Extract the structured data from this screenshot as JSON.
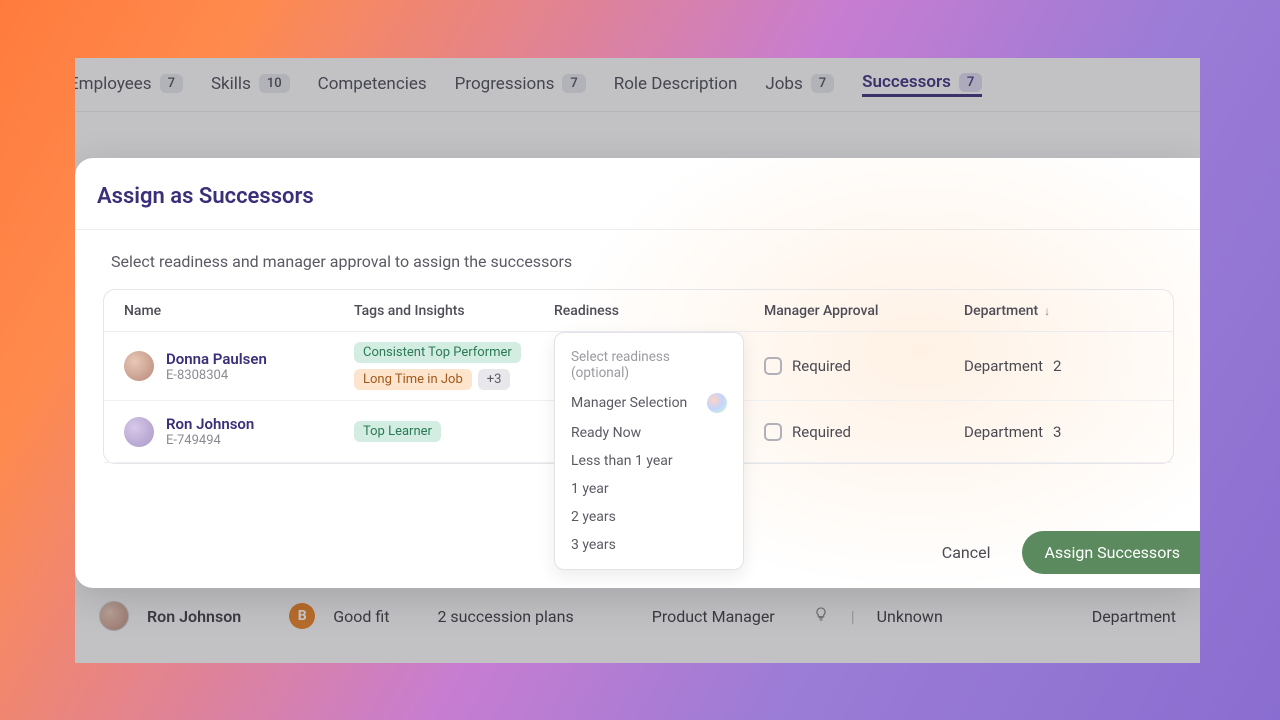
{
  "tabs": [
    {
      "label": "Employees",
      "badge": "7"
    },
    {
      "label": "Skills",
      "badge": "10"
    },
    {
      "label": "Competencies",
      "badge": ""
    },
    {
      "label": "Progressions",
      "badge": "7"
    },
    {
      "label": "Role Description",
      "badge": ""
    },
    {
      "label": "Jobs",
      "badge": "7"
    },
    {
      "label": "Successors",
      "badge": "7"
    }
  ],
  "active_tab_index": 6,
  "modal": {
    "title": "Assign as Successors",
    "subtitle": "Select readiness and manager approval to assign the successors",
    "columns": {
      "name": "Name",
      "tags": "Tags and Insights",
      "readiness": "Readiness",
      "approval": "Manager Approval",
      "department": "Department"
    },
    "rows": [
      {
        "name": "Donna Paulsen",
        "id": "E-8308304",
        "tags": [
          {
            "text": "Consistent Top Performer",
            "variant": "green"
          },
          {
            "text": "Long Time in Job",
            "variant": "orange"
          },
          {
            "text": "+3",
            "variant": "gray"
          }
        ],
        "approval": "Required",
        "department": "Department",
        "dept_num": "2"
      },
      {
        "name": "Ron Johnson",
        "id": "E-749494",
        "tags": [
          {
            "text": "Top Learner",
            "variant": "green"
          }
        ],
        "approval": "Required",
        "department": "Department",
        "dept_num": "3"
      }
    ],
    "dropdown": {
      "placeholder": "Select readiness (optional)",
      "options": [
        "Manager Selection",
        "Ready Now",
        "Less than 1 year",
        "1 year",
        "2 years",
        "3 years"
      ]
    },
    "footer": {
      "cancel": "Cancel",
      "assign": "Assign Successors"
    }
  },
  "background_row": {
    "name": "Ron Johnson",
    "fit_letter": "B",
    "fit_label": "Good fit",
    "plans": "2 succession plans",
    "role": "Product Manager",
    "unknown": "Unknown",
    "dept": "Department"
  }
}
